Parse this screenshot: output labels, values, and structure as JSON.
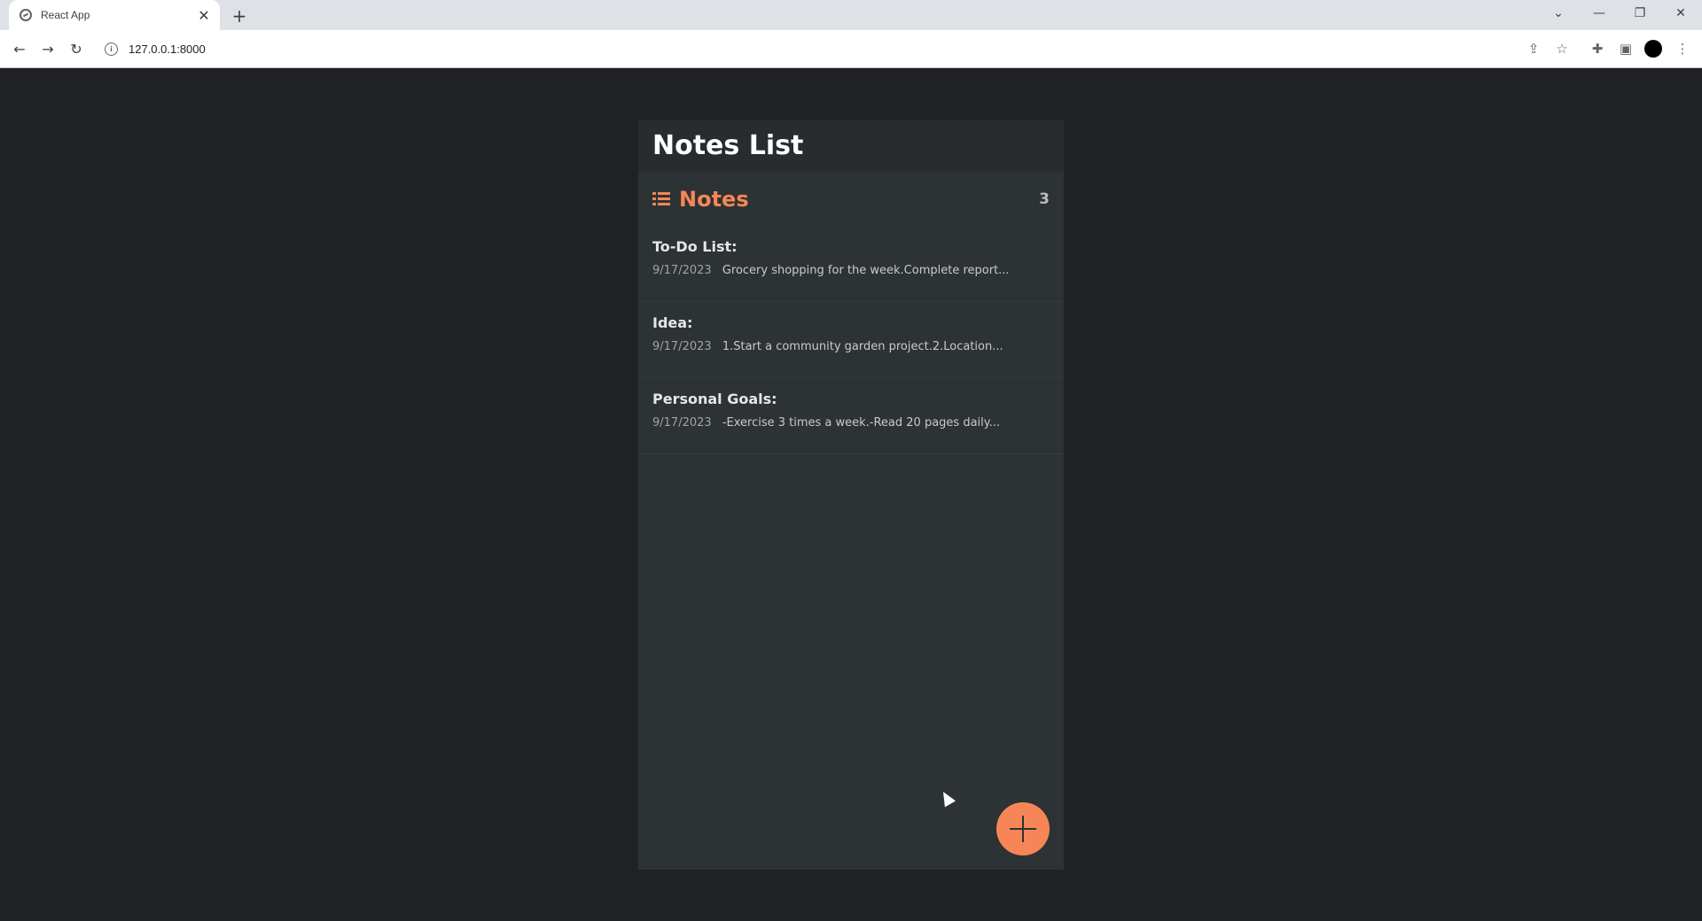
{
  "browser": {
    "tab_title": "React App",
    "tab_close": "✕",
    "new_tab": "+",
    "url": "127.0.0.1:8000",
    "controls": {
      "minimize": "—",
      "restore": "❐",
      "close": "✕",
      "tab_search": "⌄"
    },
    "nav": {
      "back": "←",
      "forward": "→",
      "reload": "↻"
    },
    "toolbar_icons": [
      "share-icon",
      "star-icon",
      "extensions-icon",
      "side-panel-icon",
      "profile-avatar",
      "menu-icon"
    ]
  },
  "app": {
    "title": "Notes List",
    "section_label": "Notes",
    "count": "3",
    "notes": [
      {
        "title": "To-Do List:",
        "date": "9/17/2023",
        "preview": "Grocery shopping for the week.Complete report..."
      },
      {
        "title": "Idea:",
        "date": "9/17/2023",
        "preview": "1.Start a community garden project.2.Location..."
      },
      {
        "title": "Personal Goals:",
        "date": "9/17/2023",
        "preview": "-Exercise 3 times a week.-Read 20 pages daily..."
      }
    ],
    "colors": {
      "accent": "#f68657",
      "background": "#1f2124",
      "card": "#2d3234"
    }
  }
}
